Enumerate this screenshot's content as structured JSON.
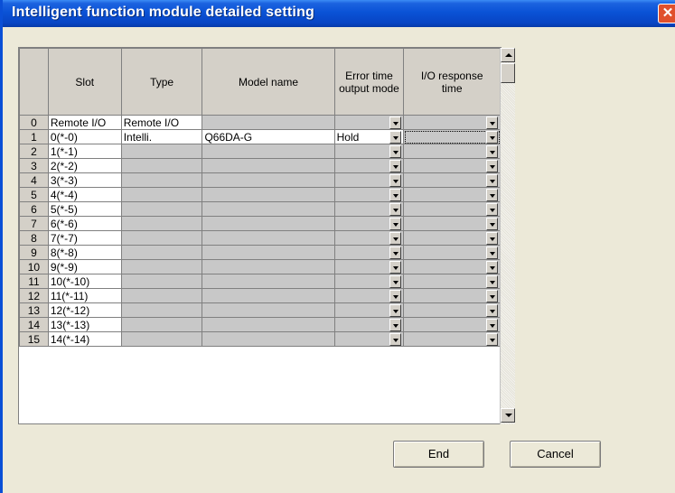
{
  "window": {
    "title": "Intelligent function module detailed setting",
    "close_glyph": "✕"
  },
  "grid": {
    "headers": [
      "Slot",
      "Type",
      "Model name",
      "Error time output mode",
      "I/O response time"
    ],
    "rows": [
      {
        "num": "0",
        "slot": "Remote I/O",
        "type": "Remote I/O",
        "model": "",
        "error_mode": "",
        "io_time": ""
      },
      {
        "num": "1",
        "slot": "0(*-0)",
        "type": "Intelli.",
        "model": "Q66DA-G",
        "error_mode": "Hold",
        "io_time": ""
      },
      {
        "num": "2",
        "slot": "1(*-1)",
        "type": "",
        "model": "",
        "error_mode": "",
        "io_time": ""
      },
      {
        "num": "3",
        "slot": "2(*-2)",
        "type": "",
        "model": "",
        "error_mode": "",
        "io_time": ""
      },
      {
        "num": "4",
        "slot": "3(*-3)",
        "type": "",
        "model": "",
        "error_mode": "",
        "io_time": ""
      },
      {
        "num": "5",
        "slot": "4(*-4)",
        "type": "",
        "model": "",
        "error_mode": "",
        "io_time": ""
      },
      {
        "num": "6",
        "slot": "5(*-5)",
        "type": "",
        "model": "",
        "error_mode": "",
        "io_time": ""
      },
      {
        "num": "7",
        "slot": "6(*-6)",
        "type": "",
        "model": "",
        "error_mode": "",
        "io_time": ""
      },
      {
        "num": "8",
        "slot": "7(*-7)",
        "type": "",
        "model": "",
        "error_mode": "",
        "io_time": ""
      },
      {
        "num": "9",
        "slot": "8(*-8)",
        "type": "",
        "model": "",
        "error_mode": "",
        "io_time": ""
      },
      {
        "num": "10",
        "slot": "9(*-9)",
        "type": "",
        "model": "",
        "error_mode": "",
        "io_time": ""
      },
      {
        "num": "11",
        "slot": "10(*-10)",
        "type": "",
        "model": "",
        "error_mode": "",
        "io_time": ""
      },
      {
        "num": "12",
        "slot": "11(*-11)",
        "type": "",
        "model": "",
        "error_mode": "",
        "io_time": ""
      },
      {
        "num": "13",
        "slot": "12(*-12)",
        "type": "",
        "model": "",
        "error_mode": "",
        "io_time": ""
      },
      {
        "num": "14",
        "slot": "13(*-13)",
        "type": "",
        "model": "",
        "error_mode": "",
        "io_time": ""
      },
      {
        "num": "15",
        "slot": "14(*-14)",
        "type": "",
        "model": "",
        "error_mode": "",
        "io_time": ""
      }
    ]
  },
  "buttons": {
    "end": "End",
    "cancel": "Cancel"
  },
  "colors": {
    "titlebar": "#0a52d6",
    "dialog_bg": "#ece9d8",
    "cell_gray": "#c8c8c8",
    "header_gray": "#d4d0c8"
  },
  "icons": [
    "close-icon",
    "dropdown-arrow-icon",
    "scroll-up-icon",
    "scroll-down-icon"
  ]
}
